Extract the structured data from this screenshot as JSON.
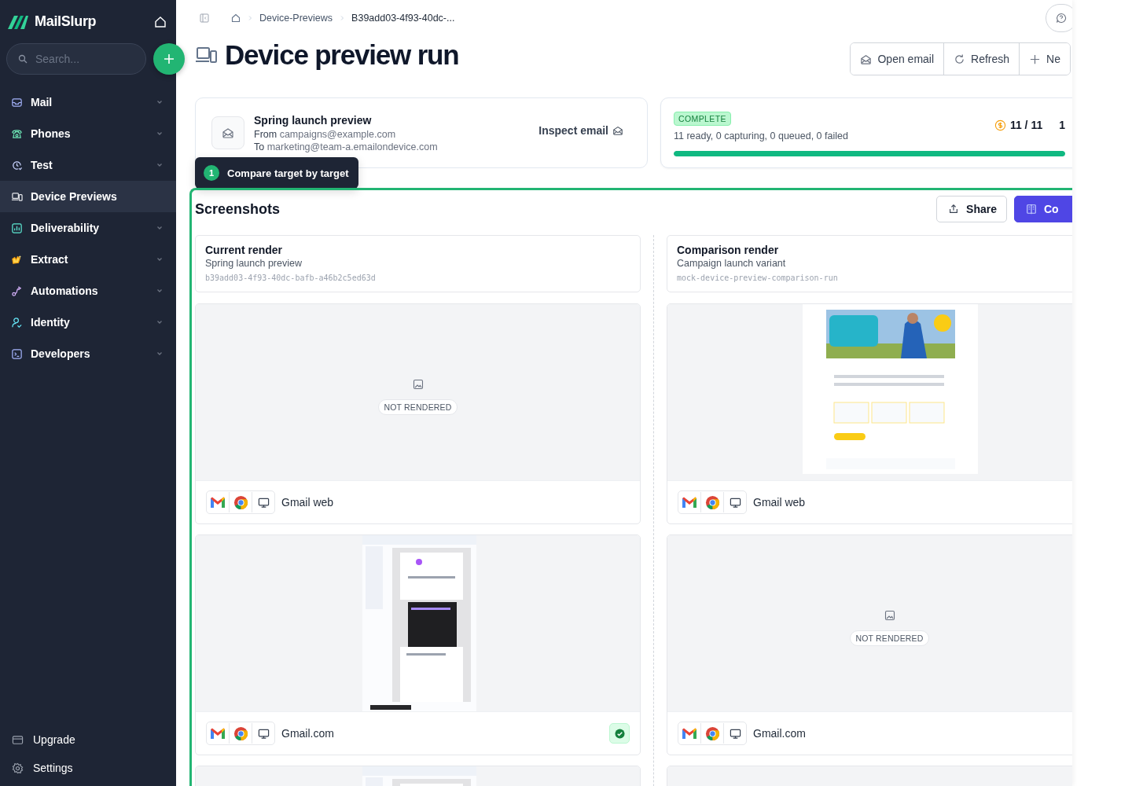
{
  "brand": "MailSlurp",
  "search": {
    "placeholder": "Search..."
  },
  "nav": [
    {
      "label": "Mail",
      "selected": false,
      "expandable": true
    },
    {
      "label": "Phones",
      "selected": false,
      "expandable": true
    },
    {
      "label": "Test",
      "selected": false,
      "expandable": true
    },
    {
      "label": "Device Previews",
      "selected": true,
      "expandable": false
    },
    {
      "label": "Deliverability",
      "selected": false,
      "expandable": true
    },
    {
      "label": "Extract",
      "selected": false,
      "expandable": true
    },
    {
      "label": "Automations",
      "selected": false,
      "expandable": true
    },
    {
      "label": "Identity",
      "selected": false,
      "expandable": true
    },
    {
      "label": "Developers",
      "selected": false,
      "expandable": true
    }
  ],
  "footer_nav": [
    {
      "label": "Upgrade"
    },
    {
      "label": "Settings"
    }
  ],
  "breadcrumb": [
    "Device-Previews",
    "B39add03-4f93-40dc-..."
  ],
  "title": "Device preview run",
  "actions": [
    "Open email",
    "Refresh",
    "Ne"
  ],
  "email_card": {
    "subject": "Spring launch preview",
    "from_label": "From",
    "from": "campaigns@example.com",
    "to_label": "To",
    "to": "marketing@team-a.emailondevice.com",
    "action": "Inspect email"
  },
  "status": {
    "badge": "COMPLETE",
    "summary": "11 ready, 0 capturing, 0 queued, 0 failed",
    "count": "11 / 11",
    "count_2": "1",
    "level": 1
  },
  "tour": {
    "step": "1",
    "text": "Compare target by target"
  },
  "screenshots": {
    "title": "Screenshots",
    "actions": [
      {
        "label": "Share",
        "kind": "outline"
      },
      {
        "label": "Co",
        "kind": "primary"
      }
    ],
    "columns": [
      {
        "title": "Current render",
        "subtitle": "Spring launch preview",
        "id": "b39add03-4f93-40dc-bafb-a46b2c5ed63d",
        "tiles": [
          {
            "kind": "empty",
            "status_label": "NOT RENDERED",
            "client": "Gmail web",
            "verified": false
          },
          {
            "kind": "picture",
            "client": "Gmail.com",
            "verified": true
          },
          {
            "kind": "picture"
          }
        ]
      },
      {
        "title": "Comparison render",
        "subtitle": "Campaign launch variant",
        "id": "mock-device-preview-comparison-run",
        "tiles": [
          {
            "kind": "picture",
            "client": "Gmail web",
            "verified": false
          },
          {
            "kind": "empty",
            "status_label": "NOT RENDERED",
            "client": "Gmail.com",
            "verified": false
          },
          {
            "kind": "empty"
          }
        ]
      }
    ]
  }
}
